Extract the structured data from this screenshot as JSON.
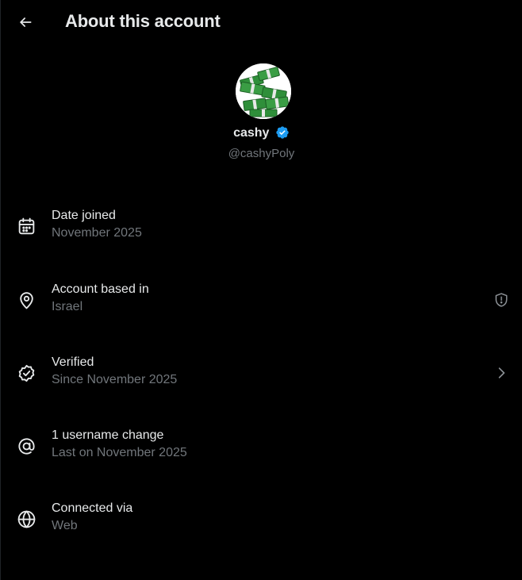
{
  "header": {
    "title": "About this account",
    "back_icon": "arrow-left-icon"
  },
  "profile": {
    "display_name": "cashy",
    "handle": "@cashyPoly",
    "verified": true,
    "verified_color": "#1d9bf0",
    "avatar_icon": "money-stack-icon"
  },
  "rows": [
    {
      "icon": "calendar-icon",
      "title": "Date joined",
      "subtitle": "November 2025"
    },
    {
      "icon": "location-pin-icon",
      "title": "Account based in",
      "subtitle": "Israel",
      "trail_icon": "shield-alert-icon"
    },
    {
      "icon": "verified-badge-outline-icon",
      "title": "Verified",
      "subtitle": "Since November 2025",
      "trail_icon": "chevron-right-icon"
    },
    {
      "icon": "at-sign-icon",
      "title": "1 username change",
      "subtitle": "Last on November 2025"
    },
    {
      "icon": "globe-icon",
      "title": "Connected via",
      "subtitle": "Web"
    }
  ],
  "colors": {
    "background": "#000000",
    "primary_text": "#e7e9ea",
    "secondary_text": "#71767b",
    "accent": "#1d9bf0"
  }
}
